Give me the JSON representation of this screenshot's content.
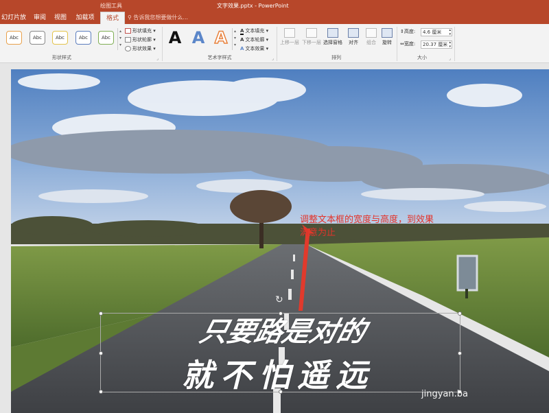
{
  "titlebar": {
    "left_tab": "绘图工具",
    "title": "文字效果.pptx - PowerPoint"
  },
  "tabs": [
    {
      "label": "幻灯片放映",
      "active": false
    },
    {
      "label": "审阅",
      "active": false
    },
    {
      "label": "视图",
      "active": false
    },
    {
      "label": "加载项",
      "active": false
    },
    {
      "label": "格式",
      "active": true
    }
  ],
  "tellme": {
    "placeholder": "告诉我您想要做什么..."
  },
  "ribbon": {
    "shape_styles": {
      "samples": [
        "Abc",
        "Abc",
        "Abc",
        "Abc",
        "Abc"
      ],
      "sample_colors": [
        "#e8a04a",
        "#888888",
        "#e3c34b",
        "#5b7dbd",
        "#7fae54"
      ],
      "fill": "形状填充",
      "outline": "形状轮廓",
      "effects": "形状效果",
      "label": "形状样式"
    },
    "wordart": {
      "samples": [
        "A",
        "A",
        "A"
      ],
      "sample_colors": [
        "#111111",
        "#5b86c9",
        "#e8813c"
      ],
      "fill": "文本填充",
      "outline": "文本轮廓",
      "effects": "文本效果",
      "label": "艺术字样式"
    },
    "arrange": {
      "bring_forward": "上移一层",
      "send_backward": "下移一层",
      "selection_pane": "选择窗格",
      "align": "对齐",
      "group": "组合",
      "rotate": "旋转",
      "label": "排列"
    },
    "size": {
      "height_label": "高度:",
      "height_value": "4.6 厘米",
      "width_label": "宽度:",
      "width_value": "20.37 厘米",
      "label": "大小"
    }
  },
  "slide": {
    "annotation_line1": "调整文本框的宽度与高度，到效果",
    "annotation_line2": "满意为止",
    "textbox_line1": "只要路是对的",
    "textbox_line2": "就不怕遥远",
    "watermark": "jingyan.ba"
  }
}
